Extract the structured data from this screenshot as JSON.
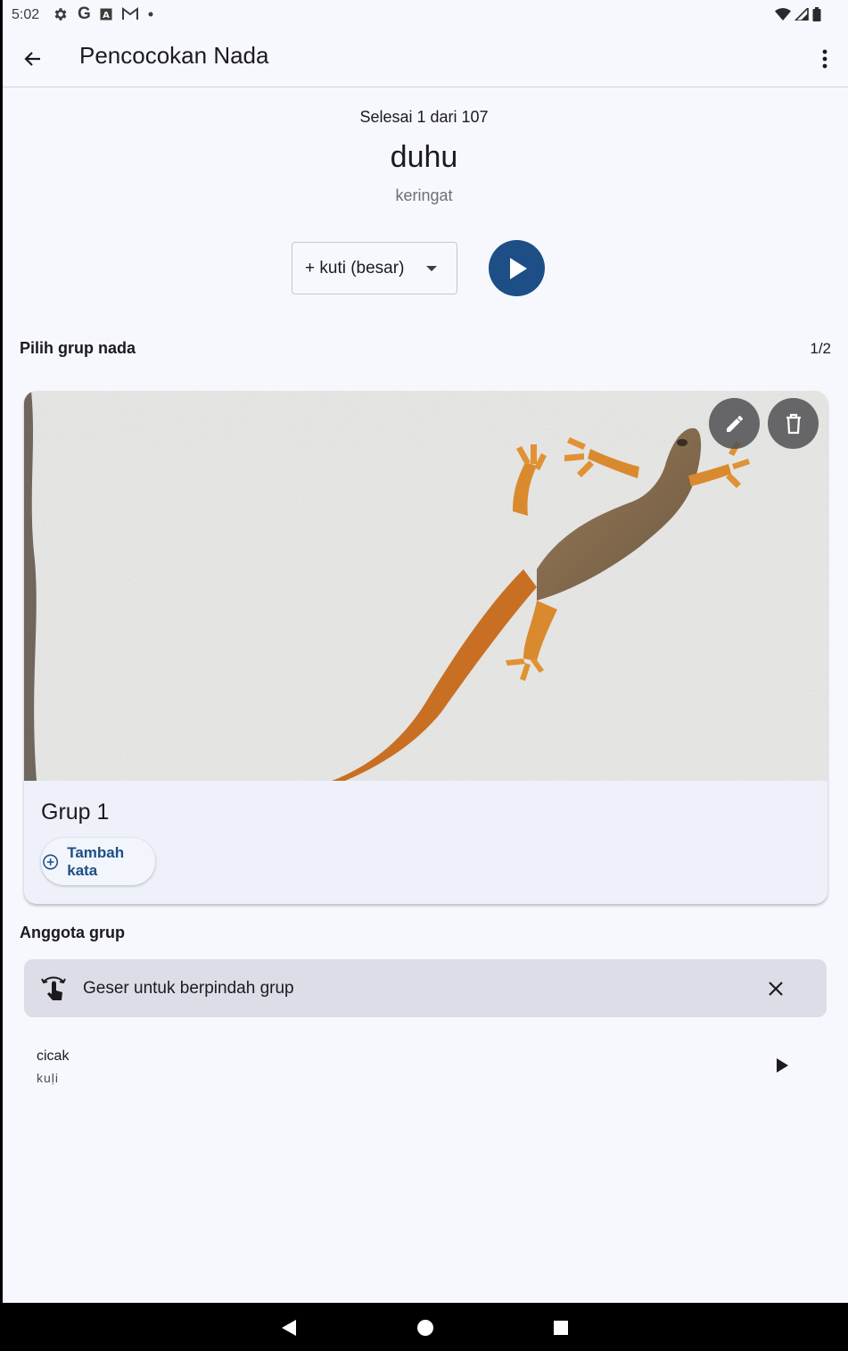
{
  "status_bar": {
    "time": "5:02",
    "left_icons": [
      "gear-icon",
      "google-icon",
      "a-icon",
      "gmail-icon",
      "dot-icon"
    ],
    "right_icons": [
      "wifi-icon",
      "signal-icon",
      "battery-icon"
    ]
  },
  "app_bar": {
    "title": "Pencocokan Nada",
    "back_icon": "arrow-left-icon",
    "menu_icon": "more-vertical-icon"
  },
  "progress": {
    "text": "Selesai 1 dari 107"
  },
  "word": {
    "main": "duhu",
    "meaning": "keringat"
  },
  "dropdown": {
    "selected": "+ kuti (besar)"
  },
  "group_section": {
    "title": "Pilih grup nada",
    "counter": "1/2"
  },
  "group_card": {
    "image": "gecko-on-wall-photo",
    "title": "Grup 1",
    "add_word_label": "Tambah kata",
    "edit_icon": "pencil-icon",
    "delete_icon": "trash-icon"
  },
  "members": {
    "title": "Anggota grup",
    "hint": "Geser untuk berpindah grup",
    "items": [
      {
        "word": "cicak",
        "pronunciation": "kuḷi"
      }
    ]
  },
  "colors": {
    "accent": "#1d4f86",
    "background": "#f7f8fe",
    "card": "#eef1fa",
    "banner": "#dcdde6"
  }
}
